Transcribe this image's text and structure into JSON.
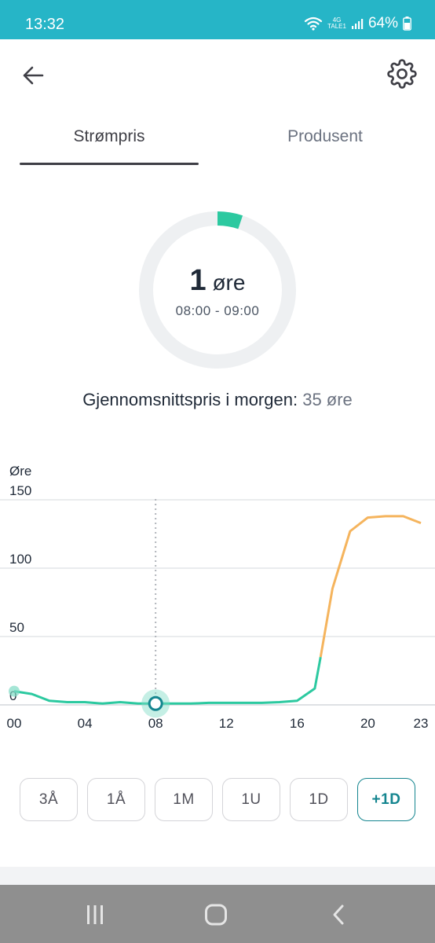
{
  "status_bar": {
    "time": "13:32",
    "network_top": "4G",
    "network_bottom": "TALE1",
    "battery": "64%",
    "icons": [
      "wifi-icon",
      "signal-icon",
      "battery-icon"
    ]
  },
  "header": {
    "back_icon": "arrow-left-icon",
    "settings_icon": "gear-icon"
  },
  "tabs": [
    {
      "label": "Strømpris",
      "active": true
    },
    {
      "label": "Produsent",
      "active": false
    }
  ],
  "current_price": {
    "value": "1",
    "unit": "øre",
    "time_range": "08:00 - 09:00"
  },
  "average": {
    "label": "Gjennomsnittspris i morgen:",
    "value": "35 øre"
  },
  "colors": {
    "accent": "#14858f",
    "header": "#26b5c7",
    "line_low": "#2cc9a0",
    "line_high": "#f5b45d",
    "gauge_track": "#eef0f2"
  },
  "chart_data": {
    "type": "line",
    "ylabel": "Øre",
    "ylim": [
      0,
      150
    ],
    "yticks": [
      0,
      50,
      100,
      150
    ],
    "xticks": [
      "00",
      "04",
      "08",
      "12",
      "16",
      "20",
      "23"
    ],
    "x": [
      0,
      1,
      2,
      3,
      4,
      5,
      6,
      7,
      8,
      9,
      10,
      11,
      12,
      13,
      14,
      15,
      16,
      17,
      17.33,
      18,
      19,
      20,
      21,
      22,
      23
    ],
    "values": [
      10,
      8,
      3,
      2,
      2,
      1,
      2,
      1,
      1,
      1,
      1,
      1.5,
      1.5,
      1.5,
      1.5,
      2,
      3,
      12,
      35,
      85,
      127,
      137,
      138,
      138,
      133
    ],
    "high_threshold": 35,
    "selected_hour": 8,
    "selected_value": 1,
    "grid": true
  },
  "range_buttons": [
    {
      "label": "3Å",
      "active": false
    },
    {
      "label": "1Å",
      "active": false
    },
    {
      "label": "1M",
      "active": false
    },
    {
      "label": "1U",
      "active": false
    },
    {
      "label": "1D",
      "active": false
    },
    {
      "label": "+1D",
      "active": true
    }
  ],
  "nav_bar": [
    "recent-apps-icon",
    "home-icon",
    "back-icon"
  ]
}
